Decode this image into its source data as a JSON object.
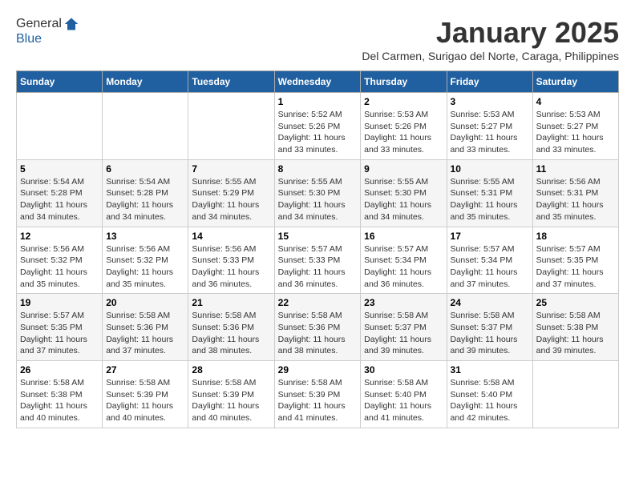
{
  "logo": {
    "line1": "General",
    "line2": "Blue"
  },
  "title": "January 2025",
  "subtitle": "Del Carmen, Surigao del Norte, Caraga, Philippines",
  "days_of_week": [
    "Sunday",
    "Monday",
    "Tuesday",
    "Wednesday",
    "Thursday",
    "Friday",
    "Saturday"
  ],
  "weeks": [
    [
      {
        "day": "",
        "sunrise": "",
        "sunset": "",
        "daylight": ""
      },
      {
        "day": "",
        "sunrise": "",
        "sunset": "",
        "daylight": ""
      },
      {
        "day": "",
        "sunrise": "",
        "sunset": "",
        "daylight": ""
      },
      {
        "day": "1",
        "sunrise": "Sunrise: 5:52 AM",
        "sunset": "Sunset: 5:26 PM",
        "daylight": "Daylight: 11 hours and 33 minutes."
      },
      {
        "day": "2",
        "sunrise": "Sunrise: 5:53 AM",
        "sunset": "Sunset: 5:26 PM",
        "daylight": "Daylight: 11 hours and 33 minutes."
      },
      {
        "day": "3",
        "sunrise": "Sunrise: 5:53 AM",
        "sunset": "Sunset: 5:27 PM",
        "daylight": "Daylight: 11 hours and 33 minutes."
      },
      {
        "day": "4",
        "sunrise": "Sunrise: 5:53 AM",
        "sunset": "Sunset: 5:27 PM",
        "daylight": "Daylight: 11 hours and 33 minutes."
      }
    ],
    [
      {
        "day": "5",
        "sunrise": "Sunrise: 5:54 AM",
        "sunset": "Sunset: 5:28 PM",
        "daylight": "Daylight: 11 hours and 34 minutes."
      },
      {
        "day": "6",
        "sunrise": "Sunrise: 5:54 AM",
        "sunset": "Sunset: 5:28 PM",
        "daylight": "Daylight: 11 hours and 34 minutes."
      },
      {
        "day": "7",
        "sunrise": "Sunrise: 5:55 AM",
        "sunset": "Sunset: 5:29 PM",
        "daylight": "Daylight: 11 hours and 34 minutes."
      },
      {
        "day": "8",
        "sunrise": "Sunrise: 5:55 AM",
        "sunset": "Sunset: 5:30 PM",
        "daylight": "Daylight: 11 hours and 34 minutes."
      },
      {
        "day": "9",
        "sunrise": "Sunrise: 5:55 AM",
        "sunset": "Sunset: 5:30 PM",
        "daylight": "Daylight: 11 hours and 34 minutes."
      },
      {
        "day": "10",
        "sunrise": "Sunrise: 5:55 AM",
        "sunset": "Sunset: 5:31 PM",
        "daylight": "Daylight: 11 hours and 35 minutes."
      },
      {
        "day": "11",
        "sunrise": "Sunrise: 5:56 AM",
        "sunset": "Sunset: 5:31 PM",
        "daylight": "Daylight: 11 hours and 35 minutes."
      }
    ],
    [
      {
        "day": "12",
        "sunrise": "Sunrise: 5:56 AM",
        "sunset": "Sunset: 5:32 PM",
        "daylight": "Daylight: 11 hours and 35 minutes."
      },
      {
        "day": "13",
        "sunrise": "Sunrise: 5:56 AM",
        "sunset": "Sunset: 5:32 PM",
        "daylight": "Daylight: 11 hours and 35 minutes."
      },
      {
        "day": "14",
        "sunrise": "Sunrise: 5:56 AM",
        "sunset": "Sunset: 5:33 PM",
        "daylight": "Daylight: 11 hours and 36 minutes."
      },
      {
        "day": "15",
        "sunrise": "Sunrise: 5:57 AM",
        "sunset": "Sunset: 5:33 PM",
        "daylight": "Daylight: 11 hours and 36 minutes."
      },
      {
        "day": "16",
        "sunrise": "Sunrise: 5:57 AM",
        "sunset": "Sunset: 5:34 PM",
        "daylight": "Daylight: 11 hours and 36 minutes."
      },
      {
        "day": "17",
        "sunrise": "Sunrise: 5:57 AM",
        "sunset": "Sunset: 5:34 PM",
        "daylight": "Daylight: 11 hours and 37 minutes."
      },
      {
        "day": "18",
        "sunrise": "Sunrise: 5:57 AM",
        "sunset": "Sunset: 5:35 PM",
        "daylight": "Daylight: 11 hours and 37 minutes."
      }
    ],
    [
      {
        "day": "19",
        "sunrise": "Sunrise: 5:57 AM",
        "sunset": "Sunset: 5:35 PM",
        "daylight": "Daylight: 11 hours and 37 minutes."
      },
      {
        "day": "20",
        "sunrise": "Sunrise: 5:58 AM",
        "sunset": "Sunset: 5:36 PM",
        "daylight": "Daylight: 11 hours and 37 minutes."
      },
      {
        "day": "21",
        "sunrise": "Sunrise: 5:58 AM",
        "sunset": "Sunset: 5:36 PM",
        "daylight": "Daylight: 11 hours and 38 minutes."
      },
      {
        "day": "22",
        "sunrise": "Sunrise: 5:58 AM",
        "sunset": "Sunset: 5:36 PM",
        "daylight": "Daylight: 11 hours and 38 minutes."
      },
      {
        "day": "23",
        "sunrise": "Sunrise: 5:58 AM",
        "sunset": "Sunset: 5:37 PM",
        "daylight": "Daylight: 11 hours and 39 minutes."
      },
      {
        "day": "24",
        "sunrise": "Sunrise: 5:58 AM",
        "sunset": "Sunset: 5:37 PM",
        "daylight": "Daylight: 11 hours and 39 minutes."
      },
      {
        "day": "25",
        "sunrise": "Sunrise: 5:58 AM",
        "sunset": "Sunset: 5:38 PM",
        "daylight": "Daylight: 11 hours and 39 minutes."
      }
    ],
    [
      {
        "day": "26",
        "sunrise": "Sunrise: 5:58 AM",
        "sunset": "Sunset: 5:38 PM",
        "daylight": "Daylight: 11 hours and 40 minutes."
      },
      {
        "day": "27",
        "sunrise": "Sunrise: 5:58 AM",
        "sunset": "Sunset: 5:39 PM",
        "daylight": "Daylight: 11 hours and 40 minutes."
      },
      {
        "day": "28",
        "sunrise": "Sunrise: 5:58 AM",
        "sunset": "Sunset: 5:39 PM",
        "daylight": "Daylight: 11 hours and 40 minutes."
      },
      {
        "day": "29",
        "sunrise": "Sunrise: 5:58 AM",
        "sunset": "Sunset: 5:39 PM",
        "daylight": "Daylight: 11 hours and 41 minutes."
      },
      {
        "day": "30",
        "sunrise": "Sunrise: 5:58 AM",
        "sunset": "Sunset: 5:40 PM",
        "daylight": "Daylight: 11 hours and 41 minutes."
      },
      {
        "day": "31",
        "sunrise": "Sunrise: 5:58 AM",
        "sunset": "Sunset: 5:40 PM",
        "daylight": "Daylight: 11 hours and 42 minutes."
      },
      {
        "day": "",
        "sunrise": "",
        "sunset": "",
        "daylight": ""
      }
    ]
  ]
}
